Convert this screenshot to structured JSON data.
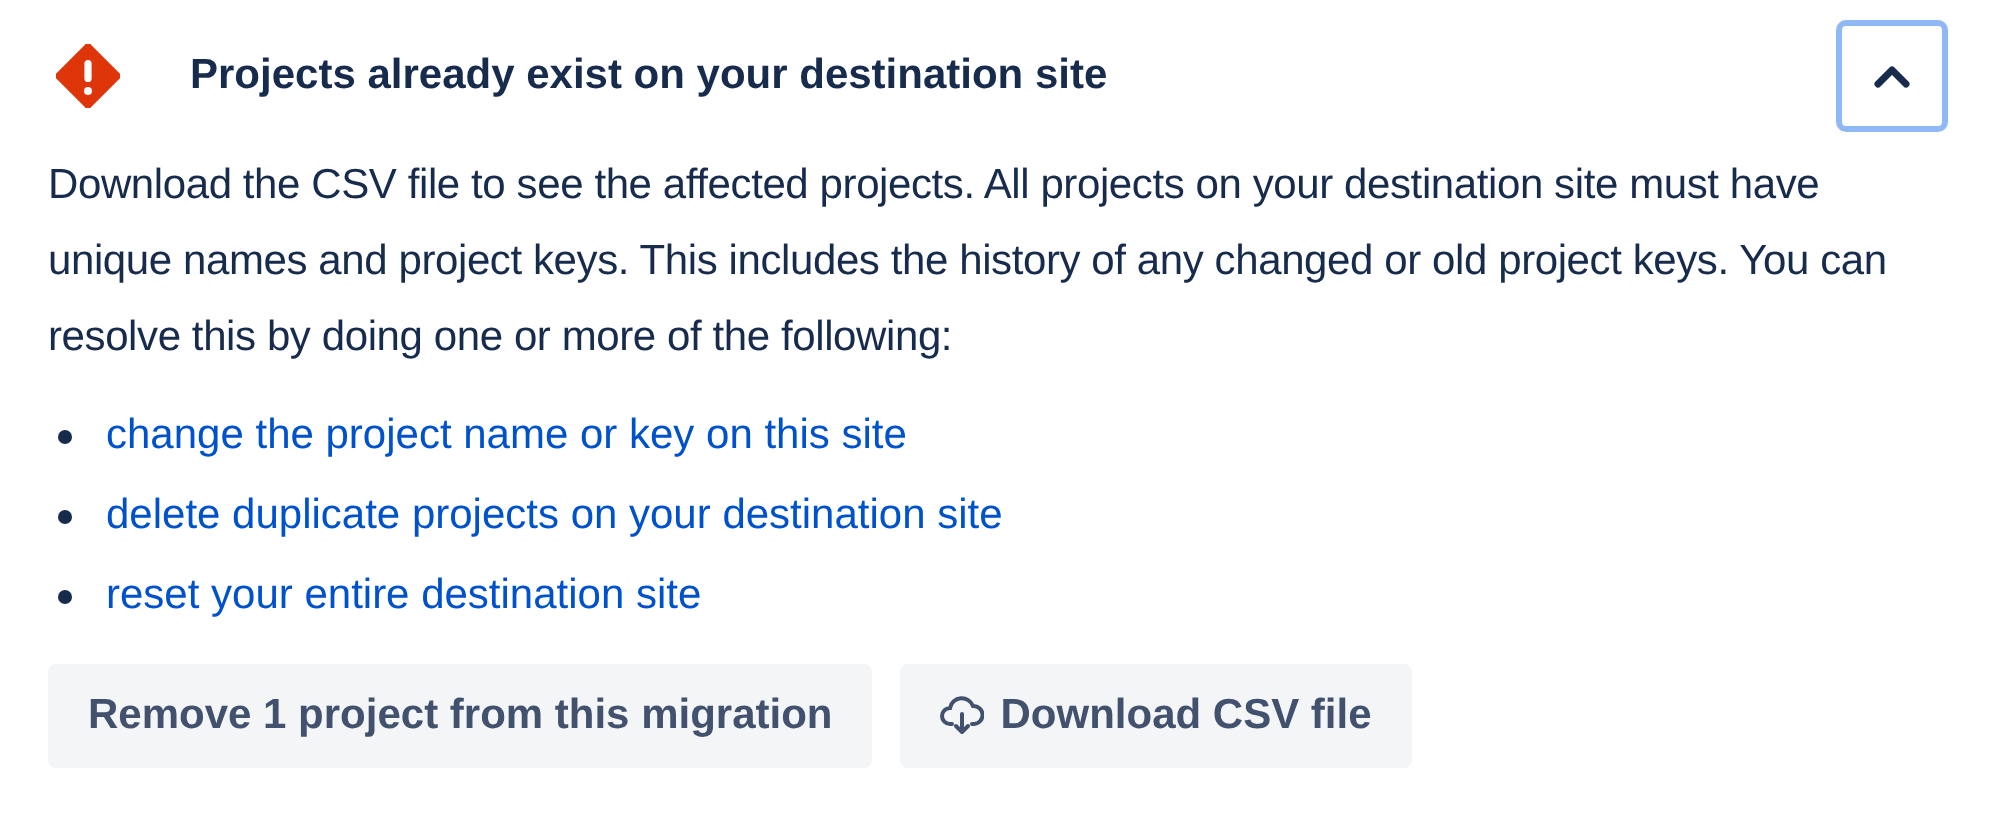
{
  "header": {
    "title": "Projects already exist on your destination site",
    "expanded": true
  },
  "description": "Download the CSV file to see the affected projects. All projects on your destination site must have unique names and project keys. This includes the history of any changed or old project keys. You can resolve this by doing one or more of the following:",
  "links": [
    "change the project name or key on this site",
    "delete duplicate projects on your destination site",
    "reset your entire destination site"
  ],
  "buttons": [
    {
      "label": "Remove 1 project from this migration",
      "kind": "plain"
    },
    {
      "label": "Download CSV file",
      "kind": "download"
    }
  ]
}
